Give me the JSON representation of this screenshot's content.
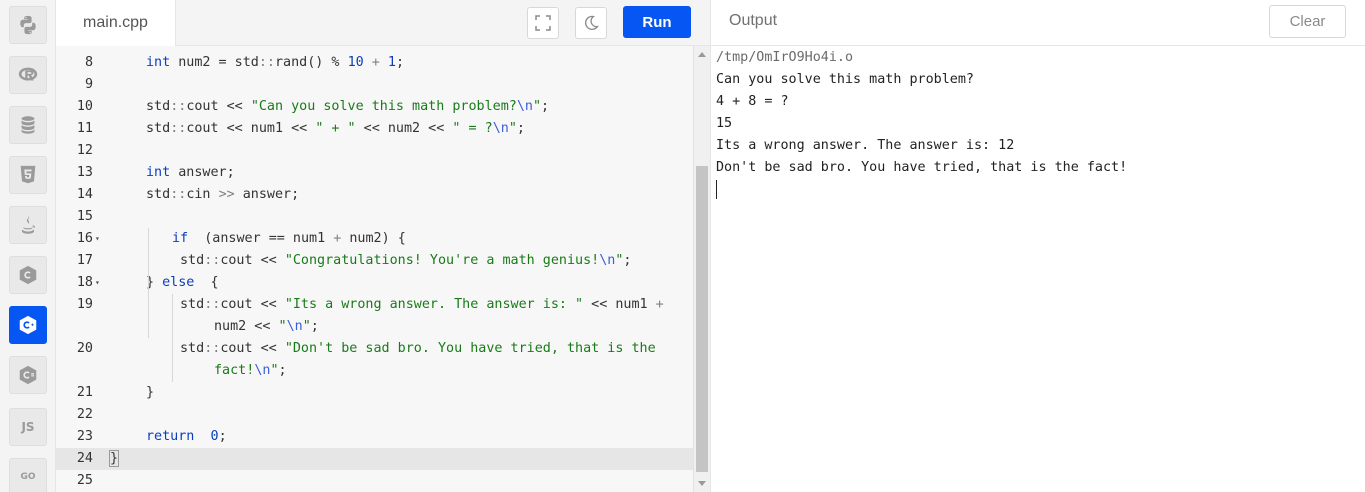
{
  "sidebar": {
    "languages": [
      {
        "name": "python",
        "icon": "python-icon"
      },
      {
        "name": "r",
        "icon": "r-icon"
      },
      {
        "name": "sql",
        "icon": "database-icon"
      },
      {
        "name": "html",
        "icon": "html5-icon"
      },
      {
        "name": "java",
        "icon": "java-icon"
      },
      {
        "name": "c",
        "icon": "c-icon"
      },
      {
        "name": "cpp",
        "icon": "cpp-icon",
        "active": true
      },
      {
        "name": "csharp",
        "icon": "csharp-icon"
      },
      {
        "name": "js",
        "label": "JS"
      },
      {
        "name": "go",
        "label": "GO"
      }
    ]
  },
  "editor": {
    "file_name": "main.cpp",
    "run_label": "Run",
    "lines": [
      {
        "n": "8",
        "tokens": [
          [
            "kw",
            "int"
          ],
          [
            "",
            "num2 = std"
          ],
          [
            "op",
            "::"
          ],
          [
            "",
            "rand() % "
          ],
          [
            "num",
            "10"
          ],
          [
            "op",
            " + "
          ],
          [
            "num",
            "1"
          ],
          [
            "",
            ";"
          ]
        ]
      },
      {
        "n": "9",
        "tokens": []
      },
      {
        "n": "10",
        "tokens": [
          [
            "",
            "std"
          ],
          [
            "op",
            "::"
          ],
          [
            "",
            "cout << "
          ],
          [
            "str",
            "\"Can you solve this math problem?"
          ],
          [
            "esc",
            "\\n"
          ],
          [
            "str",
            "\""
          ],
          [
            "",
            ";"
          ]
        ]
      },
      {
        "n": "11",
        "tokens": [
          [
            "",
            "std"
          ],
          [
            "op",
            "::"
          ],
          [
            "",
            "cout << num1 << "
          ],
          [
            "str",
            "\" + \""
          ],
          [
            "",
            ""
          ],
          [
            "op",
            " << "
          ],
          [
            "",
            "num2 << "
          ],
          [
            "str",
            "\" = ?"
          ],
          [
            "esc",
            "\\n"
          ],
          [
            "str",
            "\""
          ],
          [
            "",
            ";"
          ]
        ]
      },
      {
        "n": "12",
        "tokens": []
      },
      {
        "n": "13",
        "tokens": [
          [
            "kw",
            "int"
          ],
          [
            "",
            "answer;"
          ]
        ]
      },
      {
        "n": "14",
        "tokens": [
          [
            "",
            "std"
          ],
          [
            "op",
            "::"
          ],
          [
            "",
            "cin "
          ],
          [
            "op",
            ">>"
          ],
          [
            "",
            ""
          ],
          [
            "",
            ""
          ],
          [
            "",
            ""
          ],
          [
            "",
            "answer;"
          ]
        ]
      },
      {
        "n": "15",
        "tokens": []
      },
      {
        "n": "16",
        "fold": true,
        "tokens": [
          [
            "kw",
            "if"
          ],
          [
            "",
            " (answer == num1 "
          ],
          [
            "op",
            "+"
          ],
          [
            "",
            " num2) {"
          ]
        ]
      },
      {
        "n": "17",
        "tokens": [
          [
            "",
            "std"
          ],
          [
            "op",
            "::"
          ],
          [
            "",
            "cout << "
          ],
          [
            "str",
            "\"Congratulations! You're a math genius!"
          ],
          [
            "esc",
            "\\n"
          ],
          [
            "str",
            "\""
          ],
          [
            "",
            ";"
          ]
        ]
      },
      {
        "n": "18",
        "fold": true,
        "tokens": [
          [
            "",
            "} "
          ],
          [
            "kw",
            "else"
          ],
          [
            "",
            " {"
          ]
        ]
      },
      {
        "n": "19",
        "tokens": [
          [
            "",
            "std"
          ],
          [
            "op",
            "::"
          ],
          [
            "",
            "cout << "
          ],
          [
            "str",
            "\"Its a wrong answer. The answer is: \""
          ],
          [
            "",
            " << num1 "
          ],
          [
            "op",
            "+"
          ]
        ]
      },
      {
        "n": "",
        "tokens": [
          [
            "",
            "num2 << "
          ],
          [
            "str",
            "\""
          ],
          [
            "esc",
            "\\n"
          ],
          [
            "str",
            "\""
          ],
          [
            "",
            ";"
          ]
        ]
      },
      {
        "n": "20",
        "tokens": [
          [
            "",
            "std"
          ],
          [
            "op",
            "::"
          ],
          [
            "",
            "cout << "
          ],
          [
            "str",
            "\"Don't be sad bro. You have tried, that is the"
          ]
        ]
      },
      {
        "n": "",
        "tokens": [
          [
            "str",
            "fact!"
          ],
          [
            "esc",
            "\\n"
          ],
          [
            "str",
            "\""
          ],
          [
            "",
            ";"
          ]
        ]
      },
      {
        "n": "21",
        "tokens": [
          [
            "",
            "}"
          ]
        ]
      },
      {
        "n": "22",
        "tokens": []
      },
      {
        "n": "23",
        "tokens": [
          [
            "kw",
            "return"
          ],
          [
            "num",
            " 0"
          ],
          [
            "",
            ";"
          ]
        ]
      },
      {
        "n": "24",
        "active": true,
        "tokens": [
          [
            "",
            "}"
          ]
        ]
      },
      {
        "n": "25",
        "tokens": []
      }
    ]
  },
  "output": {
    "title": "Output",
    "clear_label": "Clear",
    "lines": [
      "/tmp/OmIrO9Ho4i.o",
      "Can you solve this math problem?",
      "4 + 8 = ?",
      "15",
      "Its a wrong answer. The answer is: 12",
      "Don't be sad bro. You have tried, that is the fact!"
    ]
  }
}
